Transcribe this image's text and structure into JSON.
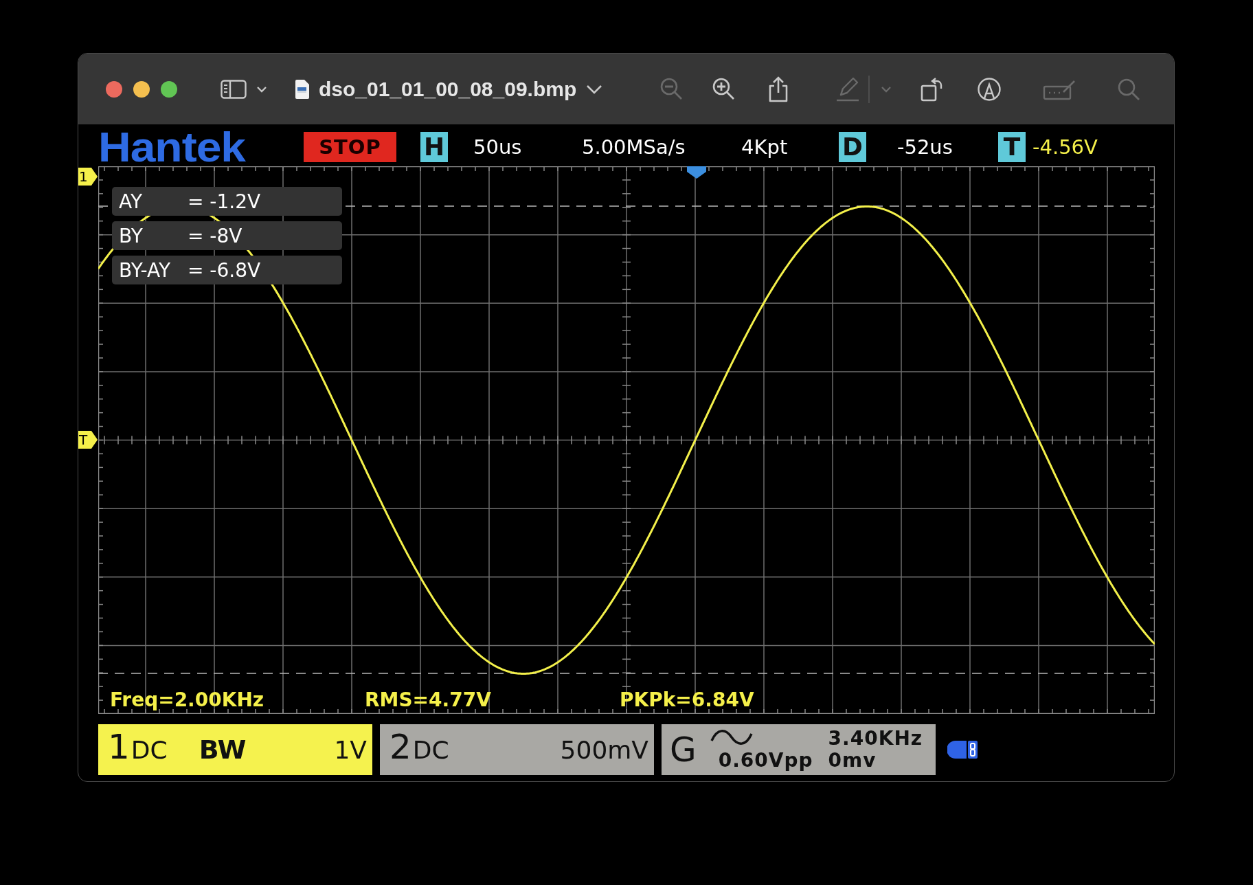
{
  "window": {
    "title": "dso_01_01_00_08_09.bmp"
  },
  "toolbar": [
    {
      "kind": "zoom-out",
      "disabled": true
    },
    {
      "kind": "zoom-in",
      "disabled": false
    },
    {
      "kind": "share",
      "disabled": false
    },
    {
      "kind": "highlight",
      "disabled": true
    },
    {
      "kind": "highlight-menu",
      "disabled": true
    },
    {
      "kind": "rotate",
      "disabled": false
    },
    {
      "kind": "markup",
      "disabled": false
    },
    {
      "kind": "sign",
      "disabled": true
    },
    {
      "kind": "search",
      "disabled": true
    }
  ],
  "scope": {
    "brand": "Hantek",
    "run_state": "STOP",
    "header": [
      {
        "kind": "badge",
        "text": "H"
      },
      {
        "kind": "value",
        "text": "50us",
        "color": "#ffffff"
      },
      {
        "kind": "value",
        "text": "5.00MSa/s",
        "color": "#ffffff"
      },
      {
        "kind": "value",
        "text": "4Kpt",
        "color": "#ffffff"
      },
      {
        "kind": "badge",
        "text": "D"
      },
      {
        "kind": "value",
        "text": "-52us",
        "color": "#ffffff"
      },
      {
        "kind": "badge",
        "text": "T"
      },
      {
        "kind": "value",
        "text": "-4.56V",
        "color": "#f5f04a"
      }
    ],
    "channel_marker": "1",
    "trigger_marker": "T",
    "cursor_readouts": [
      {
        "label": "AY",
        "value": "= -1.2V"
      },
      {
        "label": "BY",
        "value": "= -8V"
      },
      {
        "label": "BY-AY",
        "value": "= -6.8V"
      }
    ],
    "measurements": [
      "Freq=2.00KHz",
      "RMS=4.77V",
      "PKPk=6.84V"
    ],
    "channels": [
      {
        "number": "1",
        "coupling": "DC",
        "bandwidth": "BW",
        "scale": "1V",
        "color": "#f5f24e"
      },
      {
        "number": "2",
        "coupling": "DC",
        "scale": "500mV",
        "color": "#a9a8a4"
      }
    ],
    "generator": {
      "label": "G",
      "frequency": "3.40KHz",
      "amplitude": "0.60Vpp",
      "offset": "0mv"
    }
  }
}
